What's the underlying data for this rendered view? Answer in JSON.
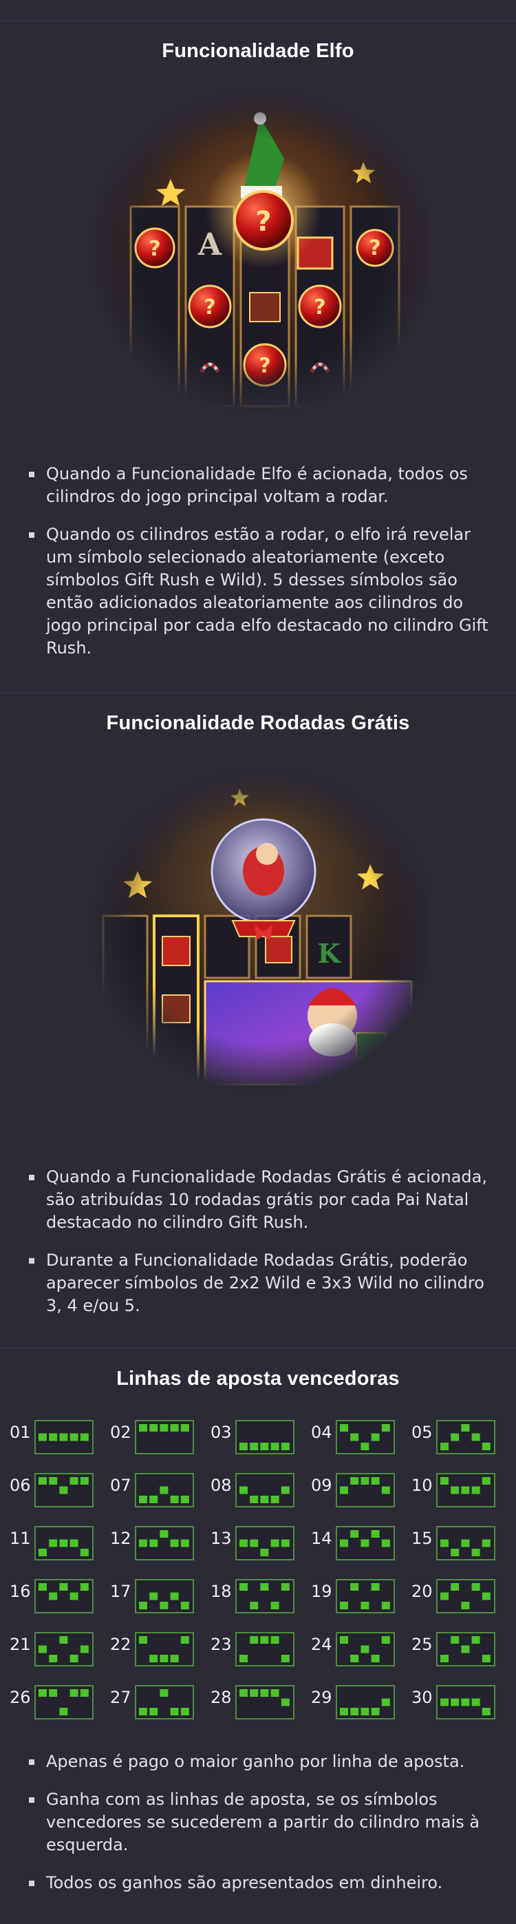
{
  "sections": [
    {
      "title": "Funcionalidade Elfo",
      "bullets": [
        "Quando a Funcionalidade Elfo é acionada, todos os cilindros do jogo principal voltam a rodar.",
        "Quando os cilindros estão a rodar, o elfo irá revelar um símbolo selecionado aleatoriamente (exceto símbolos Gift Rush e Wild). 5 desses símbolos são então adicionados aleatoriamente aos cilindros do jogo principal por cada elfo destacado no cilindro Gift Rush."
      ]
    },
    {
      "title": "Funcionalidade Rodadas Grátis",
      "bullets": [
        "Quando a Funcionalidade Rodadas Grátis é acionada, são atribuídas 10 rodadas grátis por cada Pai Natal destacado no cilindro Gift Rush.",
        "Durante a Funcionalidade Rodadas Grátis, poderão aparecer símbolos de 2x2 Wild e 3x3 Wild no cilindro 3, 4 e/ou 5."
      ]
    },
    {
      "title": "Linhas de aposta vencedoras",
      "bullets": [
        "Apenas é pago o maior ganho por linha de aposta.",
        "Ganha com as linhas de aposta, se os símbolos vencedores se sucederem a partir do cilindro mais à esquerda.",
        "Todos os ganhos são apresentados em dinheiro."
      ]
    }
  ],
  "paylines": [
    {
      "num": "01",
      "rows": [
        1,
        1,
        1,
        1,
        1
      ]
    },
    {
      "num": "02",
      "rows": [
        0,
        0,
        0,
        0,
        0
      ]
    },
    {
      "num": "03",
      "rows": [
        2,
        2,
        2,
        2,
        2
      ]
    },
    {
      "num": "04",
      "rows": [
        0,
        1,
        2,
        1,
        0
      ]
    },
    {
      "num": "05",
      "rows": [
        2,
        1,
        0,
        1,
        2
      ]
    },
    {
      "num": "06",
      "rows": [
        0,
        0,
        1,
        0,
        0
      ]
    },
    {
      "num": "07",
      "rows": [
        2,
        2,
        1,
        2,
        2
      ]
    },
    {
      "num": "08",
      "rows": [
        1,
        2,
        2,
        2,
        1
      ]
    },
    {
      "num": "09",
      "rows": [
        1,
        0,
        0,
        0,
        1
      ]
    },
    {
      "num": "10",
      "rows": [
        0,
        1,
        1,
        1,
        0
      ]
    },
    {
      "num": "11",
      "rows": [
        2,
        1,
        1,
        1,
        2
      ]
    },
    {
      "num": "12",
      "rows": [
        1,
        1,
        0,
        1,
        1
      ]
    },
    {
      "num": "13",
      "rows": [
        1,
        1,
        2,
        1,
        1
      ]
    },
    {
      "num": "14",
      "rows": [
        1,
        0,
        1,
        0,
        1
      ]
    },
    {
      "num": "15",
      "rows": [
        1,
        2,
        1,
        2,
        1
      ]
    },
    {
      "num": "16",
      "rows": [
        0,
        1,
        0,
        1,
        0
      ]
    },
    {
      "num": "17",
      "rows": [
        2,
        1,
        2,
        1,
        2
      ]
    },
    {
      "num": "18",
      "rows": [
        0,
        2,
        0,
        2,
        0
      ]
    },
    {
      "num": "19",
      "rows": [
        2,
        0,
        2,
        0,
        2
      ]
    },
    {
      "num": "20",
      "rows": [
        1,
        0,
        2,
        0,
        1
      ]
    },
    {
      "num": "21",
      "rows": [
        1,
        2,
        0,
        2,
        1
      ]
    },
    {
      "num": "22",
      "rows": [
        0,
        2,
        2,
        2,
        0
      ]
    },
    {
      "num": "23",
      "rows": [
        2,
        0,
        0,
        0,
        2
      ]
    },
    {
      "num": "24",
      "rows": [
        0,
        2,
        1,
        2,
        0
      ]
    },
    {
      "num": "25",
      "rows": [
        2,
        0,
        1,
        0,
        2
      ]
    },
    {
      "num": "26",
      "rows": [
        0,
        0,
        2,
        0,
        0
      ]
    },
    {
      "num": "27",
      "rows": [
        2,
        2,
        0,
        2,
        2
      ]
    },
    {
      "num": "28",
      "rows": [
        0,
        0,
        0,
        0,
        1
      ]
    },
    {
      "num": "29",
      "rows": [
        2,
        2,
        2,
        2,
        1
      ]
    },
    {
      "num": "30",
      "rows": [
        1,
        1,
        1,
        1,
        2
      ]
    }
  ],
  "colors": {
    "background": "#2b2a37",
    "payline_square": "#4cc42a",
    "grid_border": "#4c8f3b"
  }
}
